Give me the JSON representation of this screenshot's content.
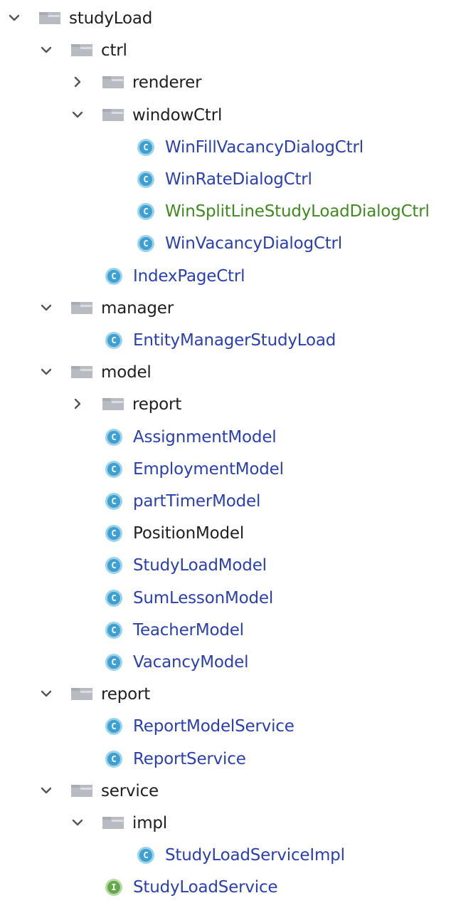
{
  "colors": {
    "folder_text": "#1e1e1e",
    "class_text": "#2a3fb0",
    "modified_text": "#3f8a1f",
    "class_icon": "#3f9fd0",
    "interface_icon": "#62a74a",
    "folder_icon": "#b8bcc2"
  },
  "icons": {
    "expanded": "chevron-down-icon",
    "collapsed": "chevron-right-icon",
    "folder": "folder-icon",
    "class": "class-icon",
    "interface": "interface-icon"
  },
  "tree": {
    "rows": [
      {
        "label": "studyLoad",
        "kind": "folder",
        "depth": 0,
        "expanded": true
      },
      {
        "label": "ctrl",
        "kind": "folder",
        "depth": 1,
        "expanded": true
      },
      {
        "label": "renderer",
        "kind": "folder",
        "depth": 2,
        "expanded": false
      },
      {
        "label": "windowCtrl",
        "kind": "folder",
        "depth": 2,
        "expanded": true
      },
      {
        "label": "WinFillVacancyDialogCtrl",
        "kind": "class",
        "depth": 3,
        "icon_letter": "C",
        "status": "normal"
      },
      {
        "label": "WinRateDialogCtrl",
        "kind": "class",
        "depth": 3,
        "icon_letter": "C",
        "status": "normal"
      },
      {
        "label": "WinSplitLineStudyLoadDialogCtrl",
        "kind": "class",
        "depth": 3,
        "icon_letter": "C",
        "status": "modified"
      },
      {
        "label": "WinVacancyDialogCtrl",
        "kind": "class",
        "depth": 3,
        "icon_letter": "C",
        "status": "normal"
      },
      {
        "label": "IndexPageCtrl",
        "kind": "class",
        "depth": 2,
        "icon_letter": "C",
        "status": "normal"
      },
      {
        "label": "manager",
        "kind": "folder",
        "depth": 1,
        "expanded": true
      },
      {
        "label": "EntityManagerStudyLoad",
        "kind": "class",
        "depth": 2,
        "icon_letter": "C",
        "status": "normal"
      },
      {
        "label": "model",
        "kind": "folder",
        "depth": 1,
        "expanded": true
      },
      {
        "label": "report",
        "kind": "folder",
        "depth": 2,
        "expanded": false
      },
      {
        "label": "AssignmentModel",
        "kind": "class",
        "depth": 2,
        "icon_letter": "C",
        "status": "normal"
      },
      {
        "label": "EmploymentModel",
        "kind": "class",
        "depth": 2,
        "icon_letter": "C",
        "status": "normal"
      },
      {
        "label": "partTimerModel",
        "kind": "class",
        "depth": 2,
        "icon_letter": "C",
        "status": "normal"
      },
      {
        "label": "PositionModel",
        "kind": "class",
        "depth": 2,
        "icon_letter": "C",
        "status": "plain"
      },
      {
        "label": "StudyLoadModel",
        "kind": "class",
        "depth": 2,
        "icon_letter": "C",
        "status": "normal"
      },
      {
        "label": "SumLessonModel",
        "kind": "class",
        "depth": 2,
        "icon_letter": "C",
        "status": "normal"
      },
      {
        "label": "TeacherModel",
        "kind": "class",
        "depth": 2,
        "icon_letter": "C",
        "status": "normal"
      },
      {
        "label": "VacancyModel",
        "kind": "class",
        "depth": 2,
        "icon_letter": "C",
        "status": "normal"
      },
      {
        "label": "report",
        "kind": "folder",
        "depth": 1,
        "expanded": true
      },
      {
        "label": "ReportModelService",
        "kind": "class",
        "depth": 2,
        "icon_letter": "C",
        "status": "normal"
      },
      {
        "label": "ReportService",
        "kind": "class",
        "depth": 2,
        "icon_letter": "C",
        "status": "normal"
      },
      {
        "label": "service",
        "kind": "folder",
        "depth": 1,
        "expanded": true
      },
      {
        "label": "impl",
        "kind": "folder",
        "depth": 2,
        "expanded": true
      },
      {
        "label": "StudyLoadServiceImpl",
        "kind": "class",
        "depth": 3,
        "icon_letter": "C",
        "status": "normal"
      },
      {
        "label": "StudyLoadService",
        "kind": "interface",
        "depth": 2,
        "icon_letter": "I",
        "status": "normal"
      }
    ]
  }
}
